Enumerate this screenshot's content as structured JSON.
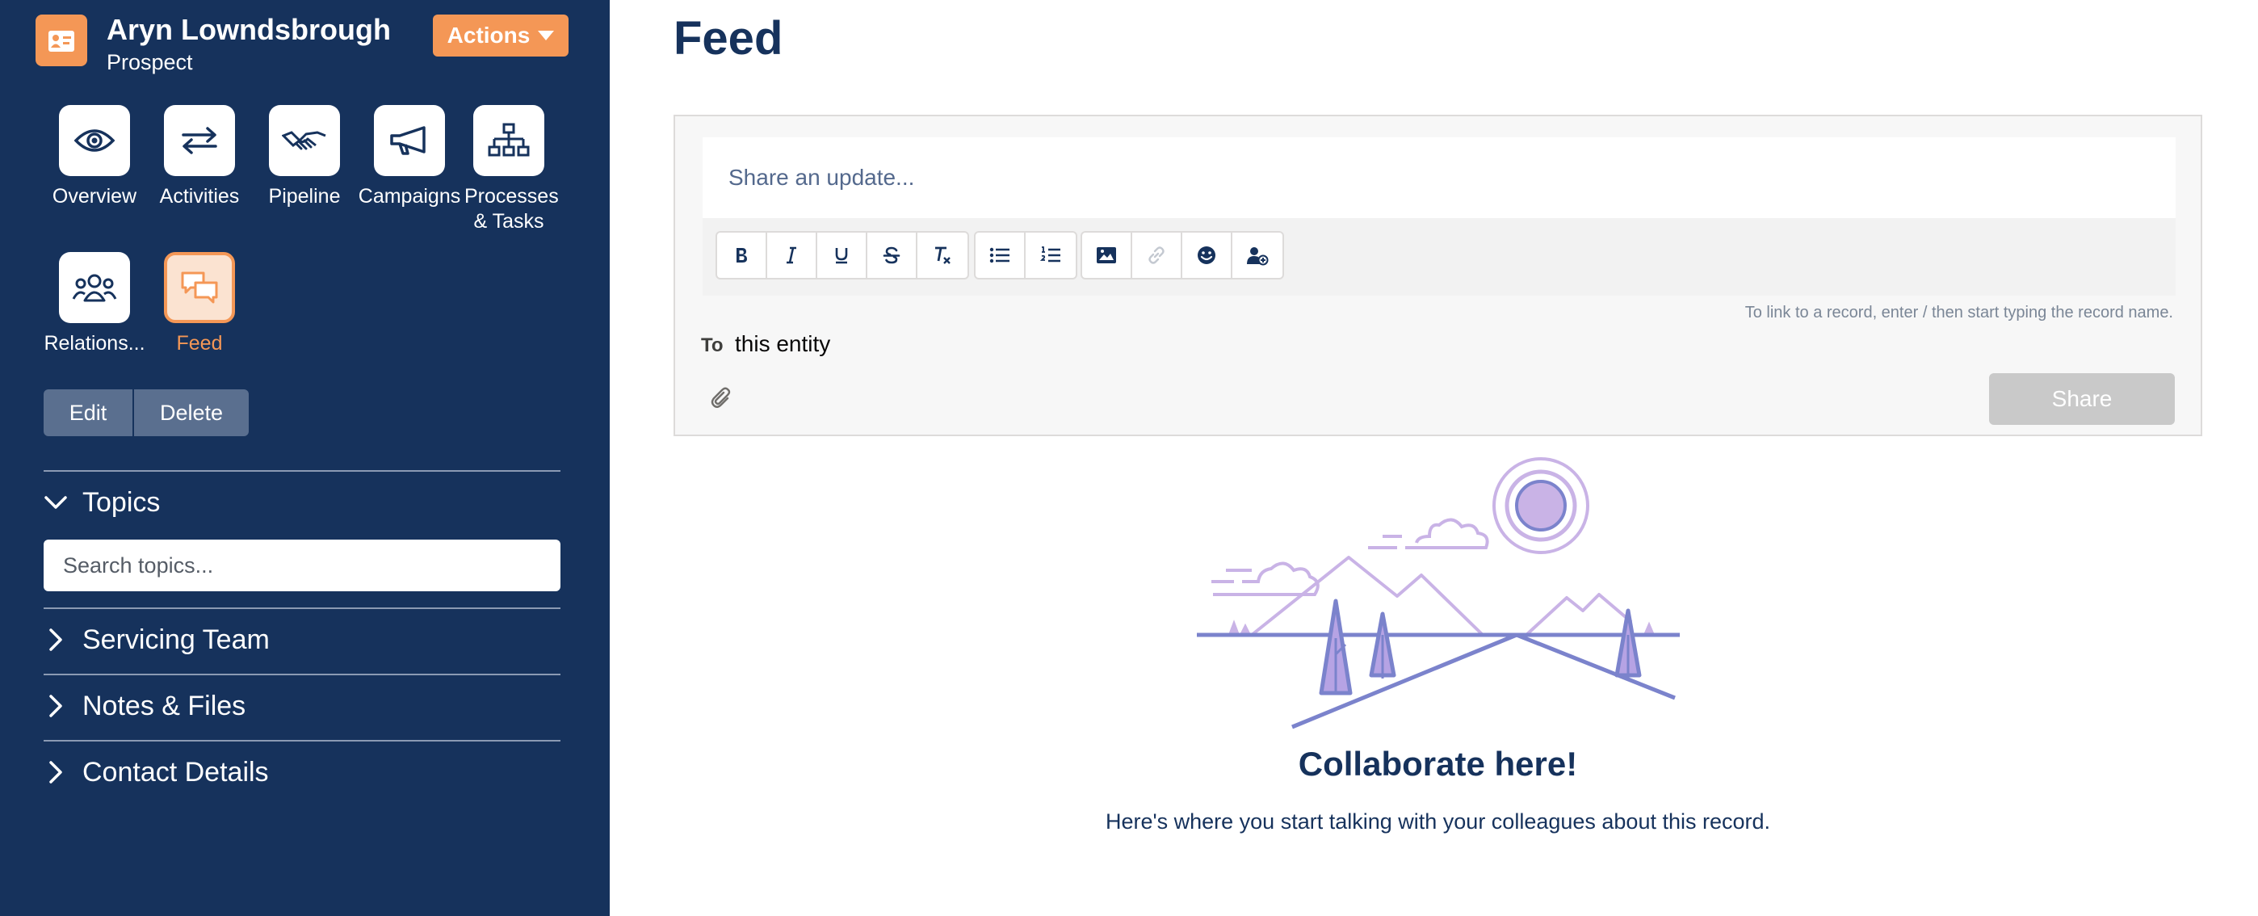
{
  "record": {
    "name": "Aryn Lowndsbrough",
    "type": "Prospect",
    "actions_label": "Actions",
    "icon": "contact-card-icon"
  },
  "nav": {
    "tiles": [
      {
        "label": "Overview",
        "icon": "eye-icon"
      },
      {
        "label": "Activities",
        "icon": "swap-arrows-icon"
      },
      {
        "label": "Pipeline",
        "icon": "handshake-icon"
      },
      {
        "label": "Campaigns",
        "icon": "megaphone-icon"
      },
      {
        "label": "Processes & Tasks",
        "icon": "hierarchy-icon"
      },
      {
        "label": "Relations...",
        "icon": "people-icon"
      },
      {
        "label": "Feed",
        "icon": "chat-bubbles-icon",
        "active": true
      }
    ]
  },
  "record_buttons": {
    "edit": "Edit",
    "delete": "Delete"
  },
  "sections": {
    "topics": {
      "label": "Topics",
      "search_placeholder": "Search topics..."
    },
    "servicing_team": "Servicing Team",
    "notes_files": "Notes & Files",
    "contact_details": "Contact Details"
  },
  "feed": {
    "title": "Feed",
    "share_placeholder": "Share an update...",
    "toolbar": [
      "bold",
      "italic",
      "underline",
      "strikethrough",
      "clear-format",
      "bullet-list",
      "numbered-list",
      "image",
      "link",
      "emoji",
      "mention"
    ],
    "hint": "To link to a record, enter / then start typing the record name.",
    "to_label": "To",
    "to_value": "this entity",
    "share_button": "Share",
    "empty_title": "Collaborate here!",
    "empty_text": "Here's where you start talking with your colleagues about this record."
  },
  "colors": {
    "sidebar": "#16325c",
    "accent": "#f49756",
    "illustration_light": "#c9b3e6",
    "illustration_dark": "#7b83cc"
  }
}
